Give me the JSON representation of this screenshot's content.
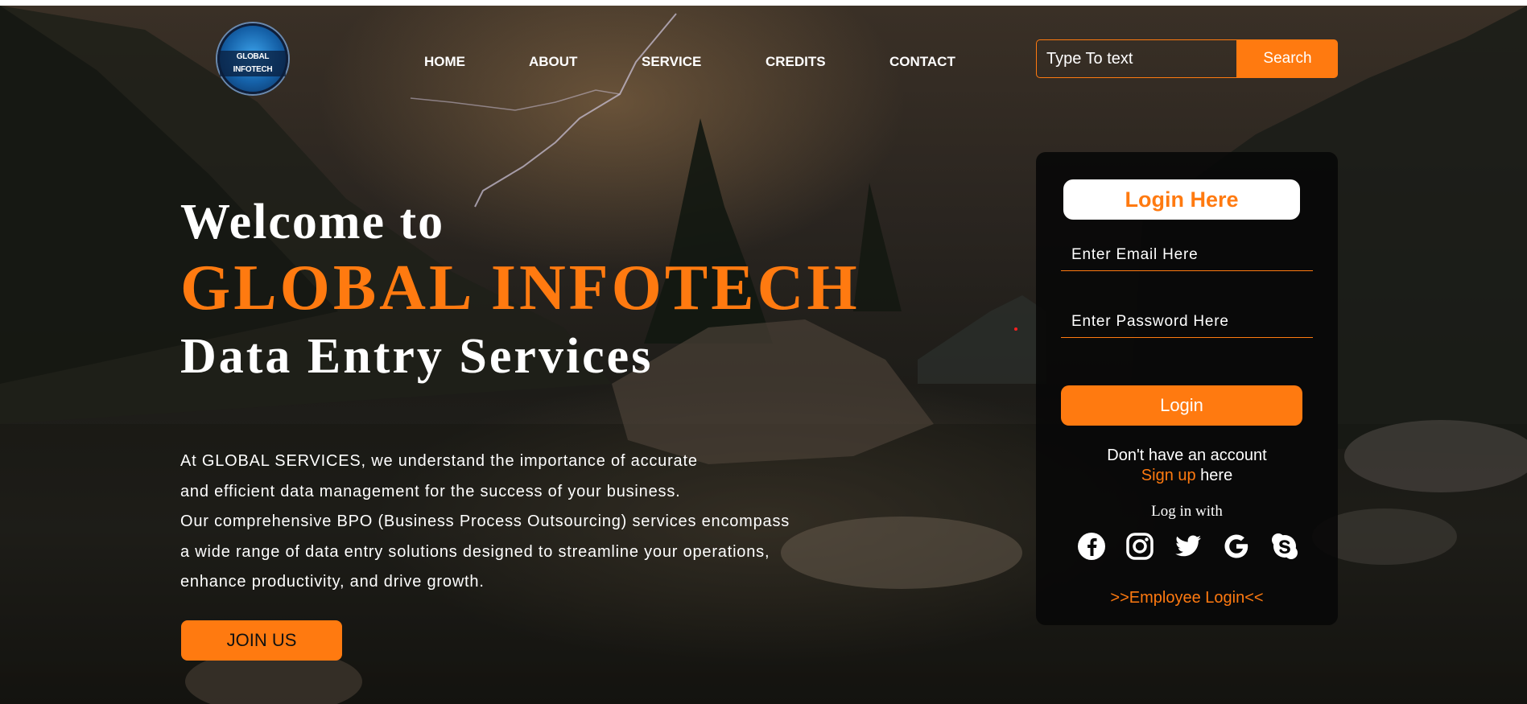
{
  "brand": {
    "logo_text": "GLOBAL INFOTECH"
  },
  "nav": {
    "items": [
      {
        "label": "HOME"
      },
      {
        "label": "ABOUT"
      },
      {
        "label": "SERVICE"
      },
      {
        "label": "CREDITS"
      },
      {
        "label": "CONTACT"
      }
    ]
  },
  "search": {
    "placeholder": "Type To text",
    "button_label": "Search"
  },
  "hero": {
    "line1": "Welcome to",
    "line2": "GLOBAL INFOTECH",
    "line3": "Data Entry Services",
    "paragraph": [
      " At GLOBAL SERVICES, we understand the importance of accurate",
      "and efficient data management for the success of your business.",
      "Our comprehensive BPO (Business Process Outsourcing) services encompass",
      "a wide range of data entry solutions designed to streamline your operations,",
      "enhance productivity, and drive growth."
    ],
    "join_label": "JOIN US"
  },
  "login": {
    "title": "Login Here",
    "email_placeholder": "Enter Email Here",
    "password_placeholder": "Enter Password Here",
    "button_label": "Login",
    "no_account_text": "Don't have an account",
    "signup_link": "Sign up",
    "signup_suffix": " here",
    "login_with": "Log in with",
    "social": [
      "facebook-icon",
      "instagram-icon",
      "twitter-icon",
      "google-icon",
      "skype-icon"
    ],
    "employee_login": ">>Employee Login<<"
  },
  "colors": {
    "accent": "#ff7a10",
    "panel": "#080808",
    "text": "#ffffff"
  }
}
